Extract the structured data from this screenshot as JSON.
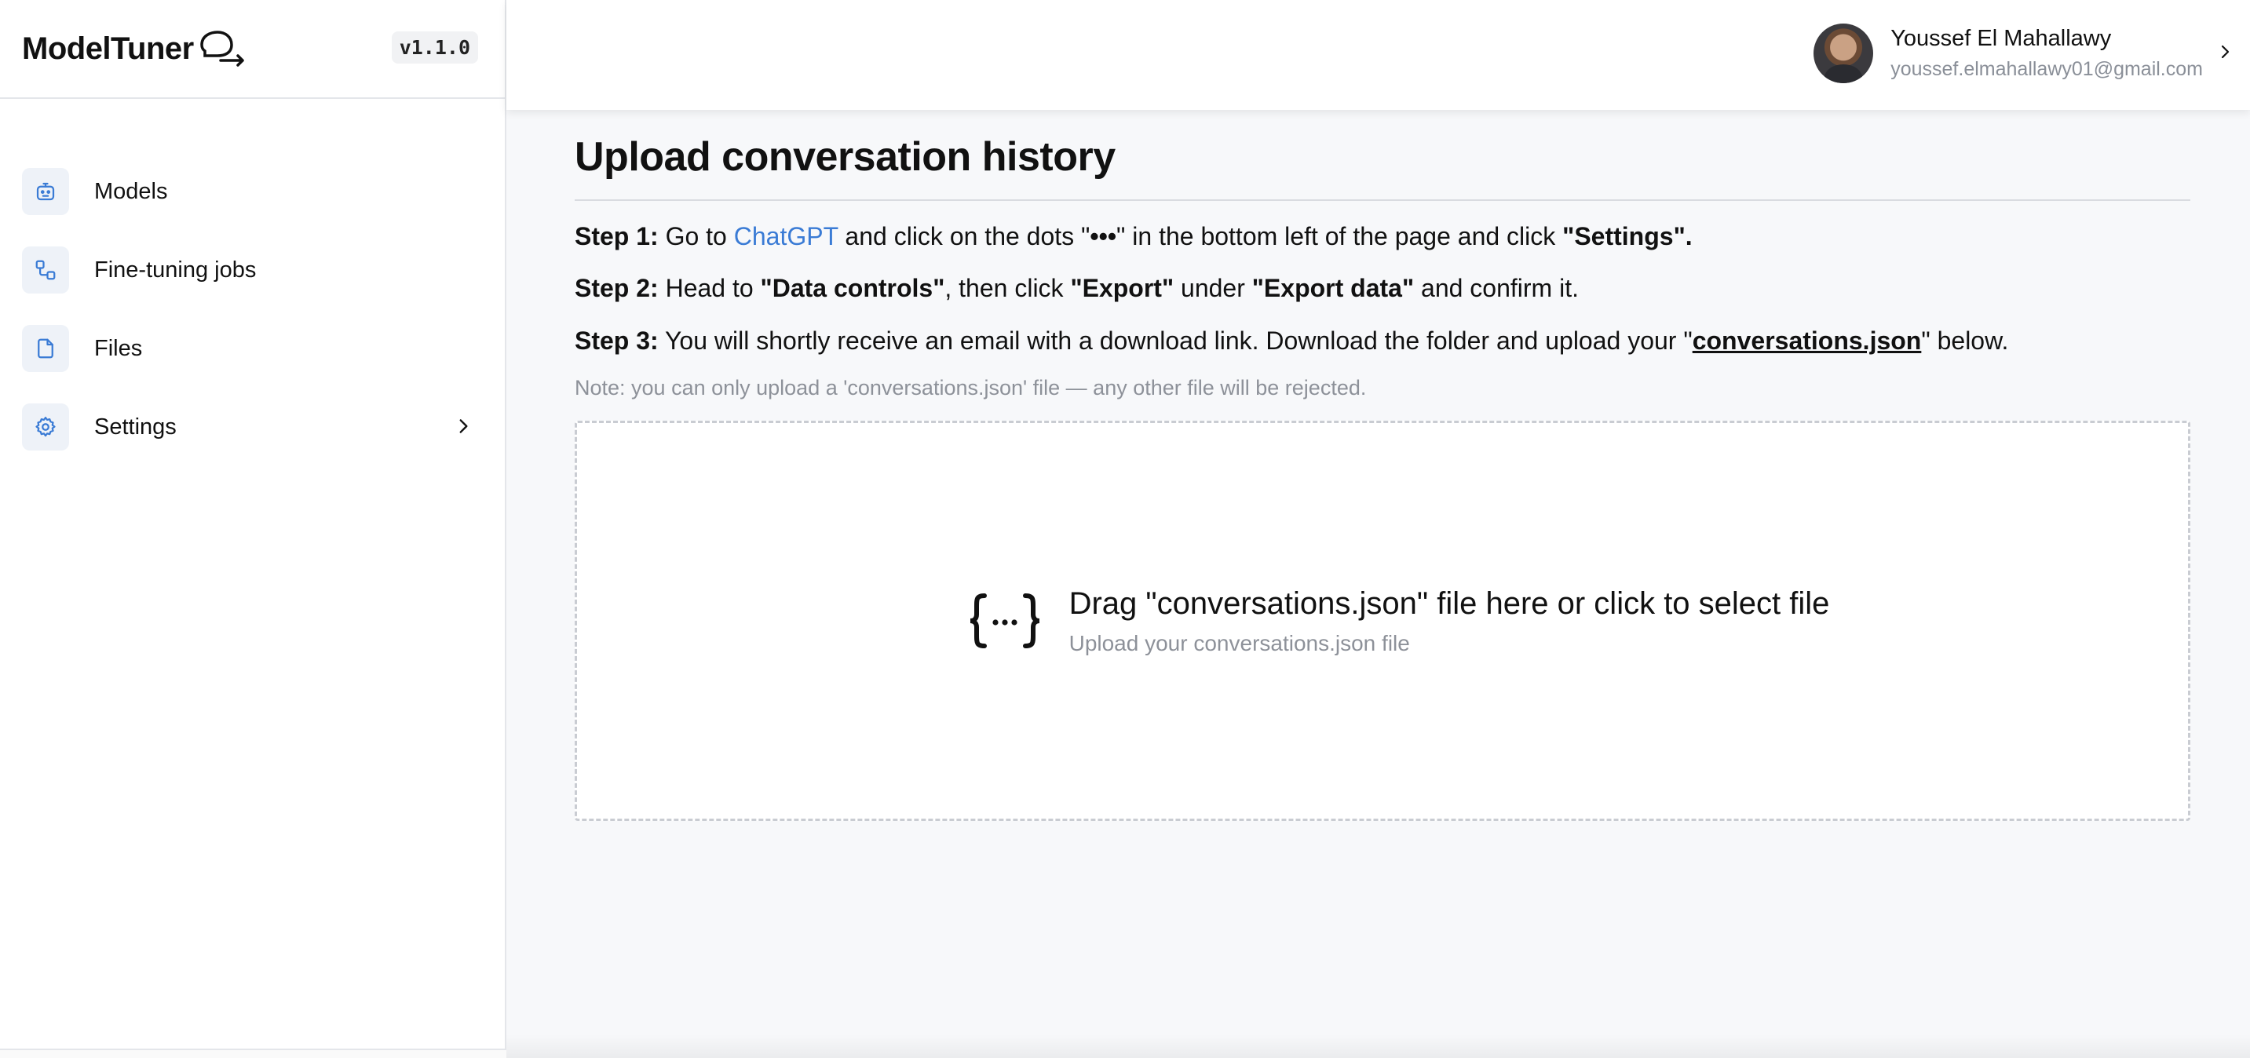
{
  "brand": {
    "name": "ModelTuner",
    "version": "v1.1.0"
  },
  "sidebar": {
    "items": [
      {
        "label": "Models",
        "icon": "robot-icon"
      },
      {
        "label": "Fine-tuning jobs",
        "icon": "workflow-icon"
      },
      {
        "label": "Files",
        "icon": "file-icon"
      },
      {
        "label": "Settings",
        "icon": "gear-icon"
      }
    ]
  },
  "user": {
    "name": "Youssef El Mahallawy",
    "email": "youssef.elmahallawy01@gmail.com"
  },
  "main": {
    "title": "Upload conversation history",
    "step1": {
      "label": "Step 1:",
      "t1": " Go to ",
      "link": "ChatGPT",
      "t2": " and click on the dots \"",
      "dots": "•••",
      "t3": "\" in the bottom left of the page and click ",
      "b1": "\"Settings\"."
    },
    "step2": {
      "label": "Step 2:",
      "t1": " Head to ",
      "b1": "\"Data controls\"",
      "t2": ", then click ",
      "b2": "\"Export\"",
      "t3": " under ",
      "b3": "\"Export data\"",
      "t4": " and confirm it."
    },
    "step3": {
      "label": "Step 3:",
      "t1": " You will shortly receive an email with a download link. Download the folder and upload your \"",
      "link": "conversations.json",
      "t2": "\" below."
    },
    "note": "Note: you can only upload a 'conversations.json' file — any other file will be rejected.",
    "dropzone": {
      "title": "Drag \"conversations.json\" file here or click to select file",
      "subtitle": "Upload your conversations.json file",
      "icon": "json-braces-icon"
    }
  },
  "colors": {
    "accent": "#3a7bd5",
    "nav_icon_bg": "#eef2f8",
    "border": "#e4e6ea"
  }
}
